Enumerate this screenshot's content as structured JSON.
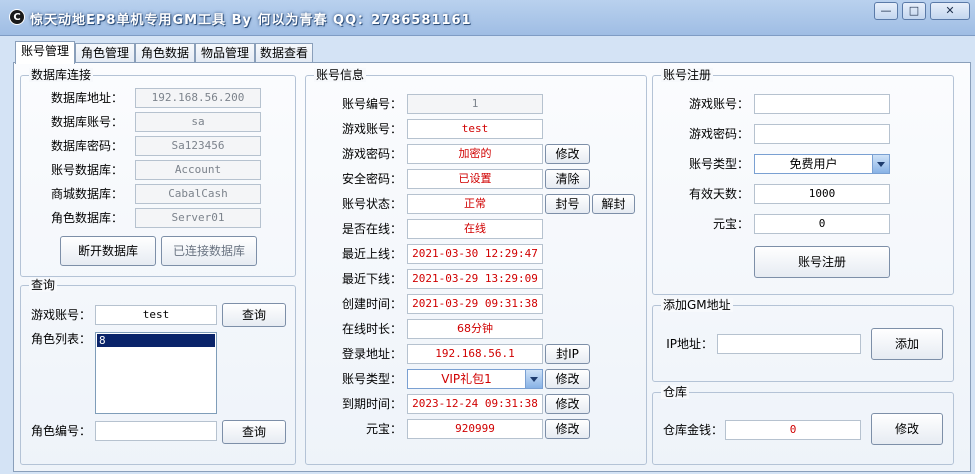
{
  "window": {
    "title": "惊天动地EP8单机专用GM工具 By 何以为青春 QQ：2786581161",
    "app_icon_glyph": "C",
    "controls": {
      "minimize": "—",
      "maximize": "□",
      "close": "✕"
    }
  },
  "tabs": [
    {
      "label": "账号管理",
      "active": true
    },
    {
      "label": "角色管理"
    },
    {
      "label": "角色数据"
    },
    {
      "label": "物品管理"
    },
    {
      "label": "数据查看"
    }
  ],
  "db": {
    "title": "数据库连接",
    "fields": [
      {
        "label": "数据库地址：",
        "value": "192.168.56.200"
      },
      {
        "label": "数据库账号：",
        "value": "sa"
      },
      {
        "label": "数据库密码：",
        "value": "Sa123456"
      },
      {
        "label": "账号数据库：",
        "value": "Account"
      },
      {
        "label": "商城数据库：",
        "value": "CabalCash"
      },
      {
        "label": "角色数据库：",
        "value": "Server01"
      }
    ],
    "disconnect_btn": "断开数据库",
    "connected_btn": "已连接数据库"
  },
  "query": {
    "title": "查询",
    "account_label": "游戏账号：",
    "account_value": "test",
    "query_btn": "查询",
    "list_label": "角色列表：",
    "list_items": [
      "8"
    ],
    "char_label": "角色编号：",
    "char_value": "",
    "query_btn2": "查询"
  },
  "info": {
    "title": "账号信息",
    "id": {
      "label": "账号编号：",
      "value": "1"
    },
    "account": {
      "label": "游戏账号：",
      "value": "test"
    },
    "password": {
      "label": "游戏密码：",
      "value": "加密的",
      "btn": "修改"
    },
    "safe_pwd": {
      "label": "安全密码：",
      "value": "已设置",
      "btn": "清除"
    },
    "status": {
      "label": "账号状态：",
      "value": "正常",
      "btn": "封号",
      "btn2": "解封"
    },
    "online": {
      "label": "是否在线：",
      "value": "在线"
    },
    "last_login": {
      "label": "最近上线：",
      "value": "2021-03-30 12:29:47"
    },
    "last_logout": {
      "label": "最近下线：",
      "value": "2021-03-29 13:29:09"
    },
    "created": {
      "label": "创建时间：",
      "value": "2021-03-29 09:31:38"
    },
    "online_time": {
      "label": "在线时长：",
      "value": "68分钟"
    },
    "login_ip": {
      "label": "登录地址：",
      "value": "192.168.56.1",
      "btn": "封IP"
    },
    "acct_type": {
      "label": "账号类型：",
      "value": "VIP礼包1",
      "btn": "修改"
    },
    "expire": {
      "label": "到期时间：",
      "value": "2023-12-24 09:31:38",
      "btn": "修改"
    },
    "yuanbao": {
      "label": "元宝：",
      "value": "920999",
      "btn": "修改"
    }
  },
  "register": {
    "title": "账号注册",
    "account_label": "游戏账号：",
    "account_value": "",
    "password_label": "游戏密码：",
    "password_value": "",
    "type_label": "账号类型：",
    "type_value": "免费用户",
    "days_label": "有效天数：",
    "days_value": "1000",
    "yuanbao_label": "元宝：",
    "yuanbao_value": "0",
    "register_btn": "账号注册"
  },
  "gm": {
    "title": "添加GM地址",
    "ip_label": "IP地址：",
    "ip_value": "",
    "add_btn": "添加"
  },
  "warehouse": {
    "title": "仓库",
    "money_label": "仓库金钱：",
    "money_value": "0",
    "modify_btn": "修改"
  },
  "colors": {
    "accent_red": "#d00000",
    "selection": "#0a246a"
  }
}
